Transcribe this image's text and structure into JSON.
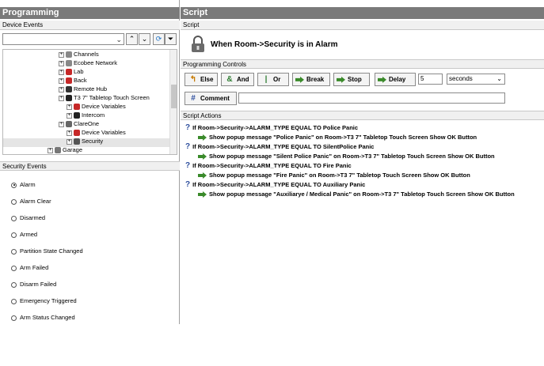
{
  "left": {
    "title": "Programming",
    "device_events_label": "Device Events",
    "tree": [
      {
        "label": "Channels",
        "indent": 1,
        "icon": "channels-icon"
      },
      {
        "label": "Ecobee Network",
        "indent": 1,
        "icon": "network-icon"
      },
      {
        "label": "Lab",
        "indent": 1,
        "icon": "room-icon"
      },
      {
        "label": "Back",
        "indent": 1,
        "icon": "room-icon"
      },
      {
        "label": "Remote Hub",
        "indent": 1,
        "icon": "hub-icon"
      },
      {
        "label": "T3 7\" Tabletop Touch Screen",
        "indent": 1,
        "icon": "touchscreen-icon"
      },
      {
        "label": "Device Variables",
        "indent": 2,
        "icon": "variables-icon"
      },
      {
        "label": "Intercom",
        "indent": 2,
        "icon": "intercom-icon"
      },
      {
        "label": "ClareOne",
        "indent": 1,
        "icon": "device-icon"
      },
      {
        "label": "Device Variables",
        "indent": 2,
        "icon": "variables-icon"
      },
      {
        "label": "Security",
        "indent": 2,
        "icon": "security-icon"
      },
      {
        "label": "Garage",
        "indent": 0,
        "icon": "garage-icon"
      }
    ],
    "security_events_label": "Security Events",
    "events": [
      "Alarm",
      "Alarm Clear",
      "Disarmed",
      "Armed",
      "Partition State Changed",
      "Arm Failed",
      "Disarm Failed",
      "Emergency Triggered",
      "Arm Status Changed"
    ]
  },
  "right": {
    "title": "Script",
    "script_label": "Script",
    "script_title": "When Room->Security is in Alarm",
    "controls_label": "Programming Controls",
    "buttons": {
      "else": "Else",
      "and": "And",
      "or": "Or",
      "break": "Break",
      "stop": "Stop",
      "delay": "Delay",
      "comment": "Comment"
    },
    "delay_value": "5",
    "delay_unit": "seconds",
    "actions_label": "Script Actions",
    "actions": [
      {
        "if": "If Room->Security->ALARM_TYPE EQUAL TO Police Panic",
        "then": "Show popup message \"Police Panic\" on Room->T3 7\" Tabletop Touch Screen Show OK Button"
      },
      {
        "if": "If Room->Security->ALARM_TYPE EQUAL TO SilentPolice Panic",
        "then": "Show popup message \"Silent Police Panic\" on Room->T3 7\" Tabletop Touch Screen Show OK Button"
      },
      {
        "if": "If Room->Security->ALARM_TYPE EQUAL TO Fire Panic",
        "then": "Show popup message \"Fire Panic\" on Room->T3 7\" Tabletop Touch Screen Show OK Button"
      },
      {
        "if": "If Room->Security->ALARM_TYPE EQUAL TO Auxiliary Panic",
        "then": "Show popup message \"Auxiliarye / Medical Panic\" on Room->T3 7\" Tabletop Touch Screen Show OK Button"
      }
    ]
  }
}
